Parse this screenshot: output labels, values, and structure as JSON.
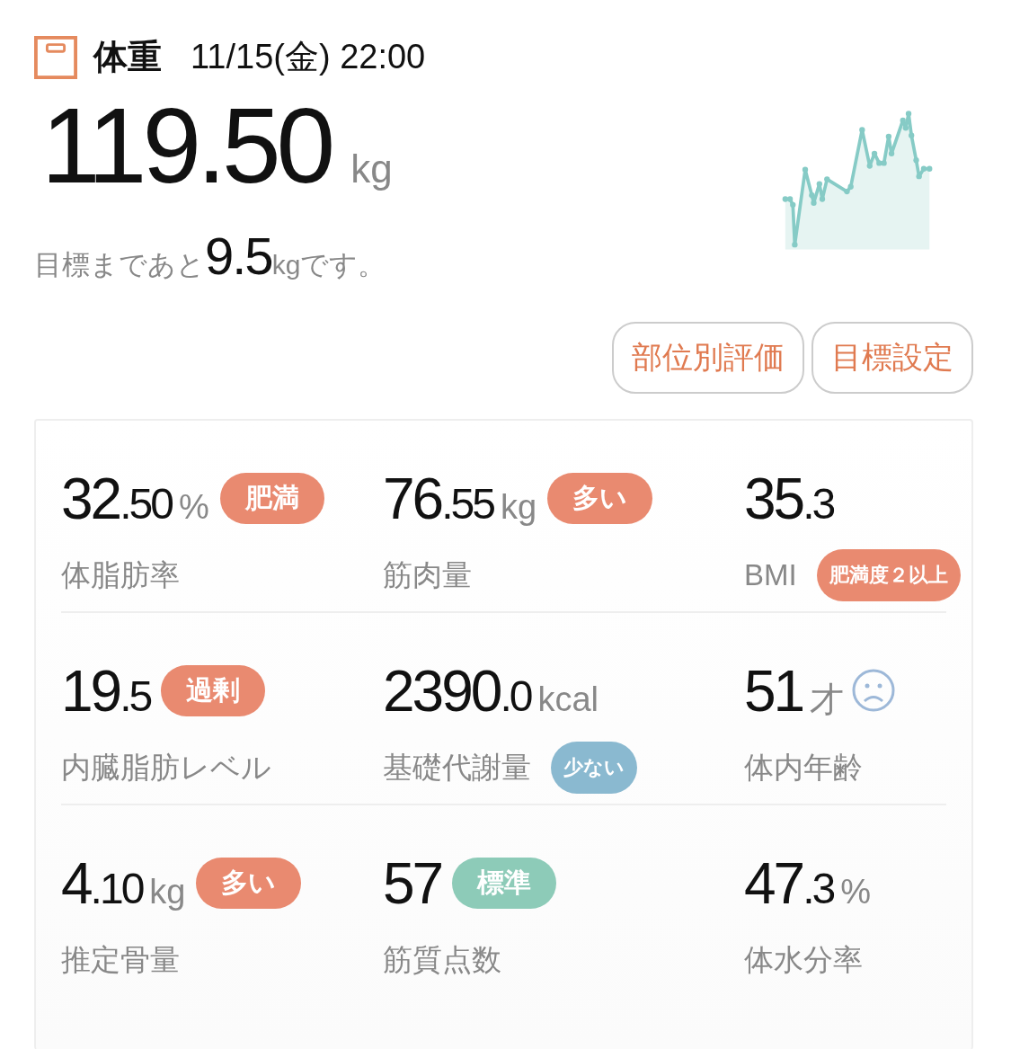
{
  "header": {
    "title": "体重",
    "datetime": "11/15(金) 22:00"
  },
  "weight": {
    "value": "119.50",
    "unit": "kg"
  },
  "goal": {
    "prefix": "目標まであと",
    "value": "9.5",
    "unit": "kg",
    "suffix": "です。"
  },
  "buttons": [
    "部位別評価",
    "目標設定"
  ],
  "metrics": [
    {
      "kind": "value-badge",
      "value": "32.50",
      "unit": "%",
      "label": "体脂肪率",
      "badge": {
        "text": "肥満",
        "color": "#e98a70"
      }
    },
    {
      "kind": "value-badge",
      "value": "76.55",
      "unit": "kg",
      "label": "筋肉量",
      "badge": {
        "text": "多い",
        "color": "#e98a70"
      }
    },
    {
      "kind": "label-badge",
      "value": "35.3",
      "label": "BMI",
      "badge": {
        "text": "肥満度２以上",
        "color": "#e98a70"
      }
    },
    {
      "kind": "value-badge",
      "value": "19.5",
      "label": "内臓脂肪レベル",
      "badge": {
        "text": "過剰",
        "color": "#e98a70"
      }
    },
    {
      "kind": "label-badge",
      "value": "2390.0",
      "unit": "kcal",
      "label": "基礎代謝量",
      "badge": {
        "text": "少ない",
        "color": "#8ab9d0"
      }
    },
    {
      "kind": "icon",
      "value": "51",
      "unit": "才",
      "label": "体内年齢"
    },
    {
      "kind": "value-badge",
      "value": "4.10",
      "unit": "kg",
      "label": "推定骨量",
      "badge": {
        "text": "多い",
        "color": "#e98a70"
      }
    },
    {
      "kind": "value-badge",
      "value": "57",
      "label": "筋質点数",
      "badge": {
        "text": "標準",
        "color": "#8dcbb8"
      }
    },
    {
      "kind": "plain",
      "value": "47.3",
      "unit": "%",
      "label": "体水分率"
    }
  ]
}
